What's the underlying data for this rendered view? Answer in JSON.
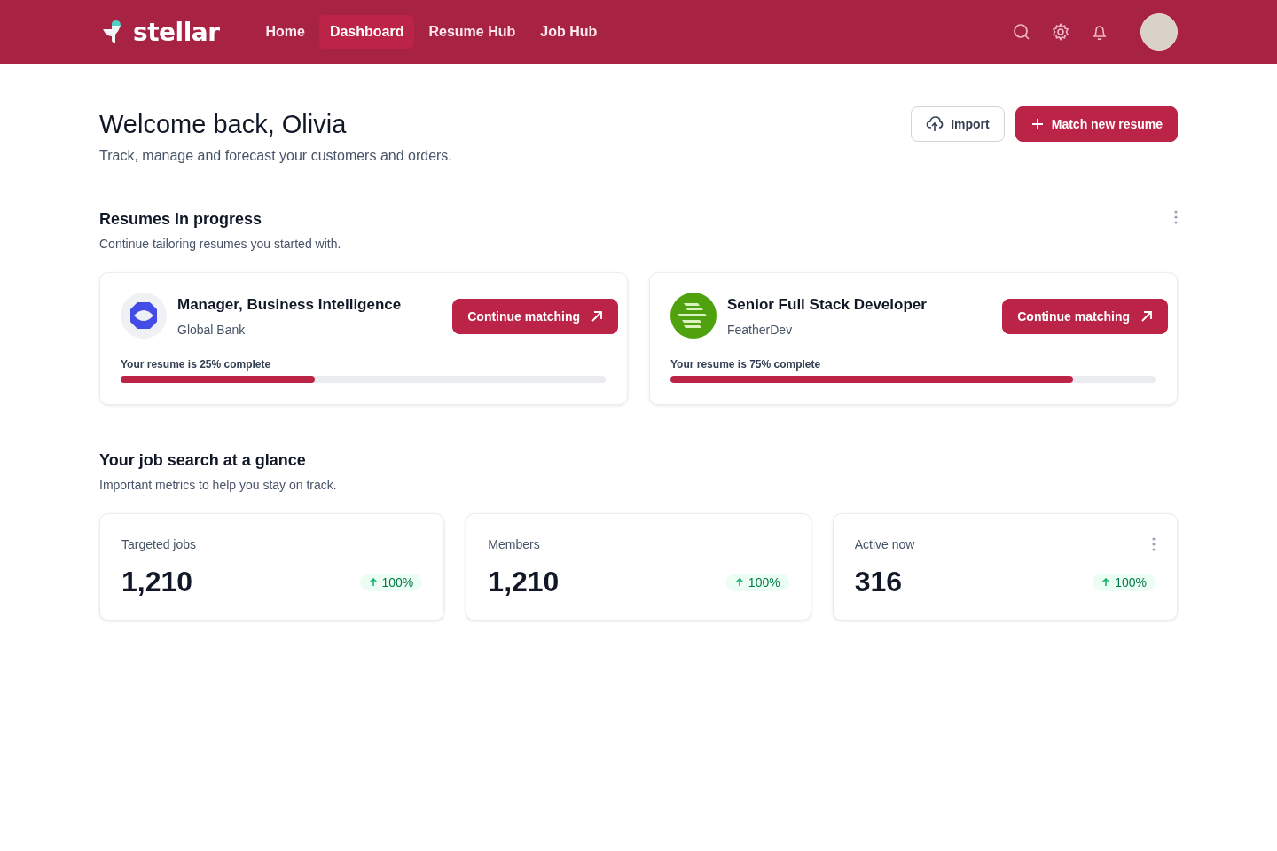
{
  "brand": {
    "name": "stellar"
  },
  "nav": [
    {
      "label": "Home",
      "selected": false
    },
    {
      "label": "Dashboard",
      "selected": true
    },
    {
      "label": "Resume Hub",
      "selected": false
    },
    {
      "label": "Job Hub",
      "selected": false
    }
  ],
  "header": {
    "title": "Welcome back, Olivia",
    "subtitle": "Track, manage and forecast your customers and orders.",
    "buttons": [
      {
        "label": "Import",
        "kind": "secondary"
      },
      {
        "label": "Match new resume",
        "kind": "primary"
      }
    ]
  },
  "resumes": {
    "title": "Resumes in progress",
    "subtitle": "Continue tailoring resumes you started with.",
    "items": [
      {
        "title": "Manager, Business Intelligence",
        "company": "Global Bank",
        "kind": "octagon",
        "button": "Continue matching",
        "progress_label": "Your resume is 25% complete",
        "level": 0.4
      },
      {
        "title": "Senior Full Stack Developer",
        "company": "FeatherDev",
        "kind": "stripes",
        "button": "Continue matching",
        "progress_label": "Your resume is 75% complete",
        "level": 0.83
      }
    ]
  },
  "metrics": {
    "title": "Your job search at a glance",
    "subtitle": "Important metrics to help you stay on track.",
    "items": [
      {
        "label": "Targeted jobs",
        "value": "1,210",
        "change": "100%",
        "menu": false
      },
      {
        "label": "Members",
        "value": "1,210",
        "change": "100%",
        "menu": false
      },
      {
        "label": "Active now",
        "value": "316",
        "change": "100%",
        "menu": true
      }
    ]
  }
}
